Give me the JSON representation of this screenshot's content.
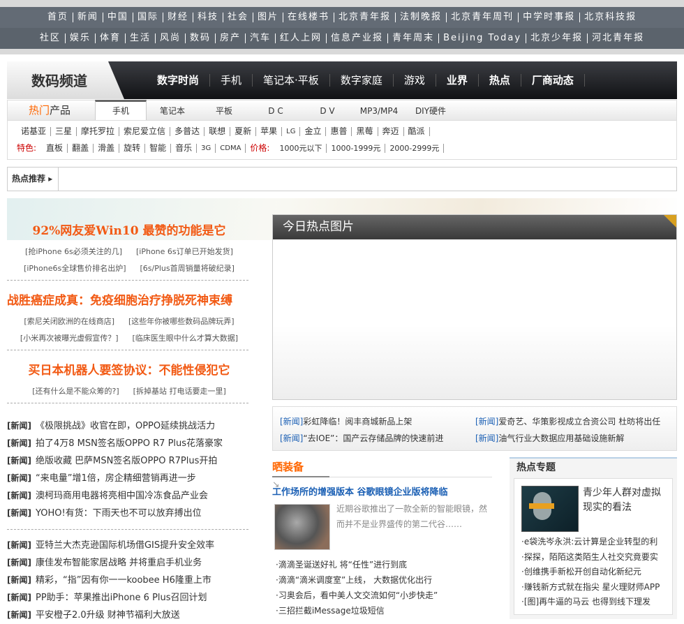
{
  "topnav": {
    "row1": [
      "首页",
      "新闻",
      "中国",
      "国际",
      "财经",
      "科技",
      "社会",
      "图片",
      "在线楼书",
      "北京青年报",
      "法制晚报",
      "北京青年周刊",
      "中学时事报",
      "北京科技报"
    ],
    "row2": [
      "社区",
      "娱乐",
      "体育",
      "生活",
      "风尚",
      "数码",
      "房产",
      "汽车",
      "红人上网",
      "信息产业报",
      "青年周末",
      "Beijing  Today",
      "北京少年报",
      "河北青年报"
    ]
  },
  "channel": {
    "title": "数码频道",
    "nav": [
      "数字时尚",
      "手机",
      "笔记本·平板",
      "数字家庭",
      "游戏",
      "业界",
      "热点",
      "厂商动态"
    ]
  },
  "products": {
    "title_hot": "热门",
    "title_rest": "产品",
    "tabs": [
      "手机",
      "笔记本",
      "平板",
      "D C",
      "D V",
      "MP3/MP4",
      "DIY硬件"
    ],
    "brands": [
      "诺基亚",
      "三星",
      "摩托罗拉",
      "索尼爱立信",
      "多普达",
      "联想",
      "夏新",
      "苹果",
      "LG",
      "金立",
      "惠普",
      "黑莓",
      "奔迈",
      "酷派"
    ],
    "feature_label": "特色:",
    "features": [
      "直板",
      "翻盖",
      "滑盖",
      "旋转",
      "智能",
      "音乐",
      "3G",
      "CDMA"
    ],
    "price_label": "价格:",
    "prices": [
      "1000元以下",
      "1000-1999元",
      "2000-2999元"
    ]
  },
  "hot_rec": {
    "label": "热点推荐"
  },
  "headlines": [
    {
      "title": "92%网友爱Win10 最赞的功能是它",
      "subs": [
        [
          "[抢iPhone 6s必须关注的几]",
          "[iPhone 6s订单已开始发货]"
        ],
        [
          "[iPhone6s全球售价排名出炉]",
          "[6s/Plus首周销量将破纪录]"
        ]
      ]
    },
    {
      "title": "战胜癌症成真：免疫细胞治疗挣脱死神束缚",
      "subs": [
        [
          "[索尼关闭欧洲的在线商店]",
          "[这些年你被哪些数码品牌玩弄]"
        ],
        [
          "[小米再次被曝光虚假宣传？]",
          "[临床医生眼中什么才算大数据]"
        ]
      ]
    },
    {
      "title": "买日本机器人要签协议：不能性侵犯它",
      "subs": [
        [
          "[还有什么是不能众筹的?]",
          "[拆掉基站 打电话要走一里]"
        ]
      ]
    }
  ],
  "news_tag": "[新闻]",
  "news1": [
    "《极限挑战》收官在即，OPPO延续挑战活力",
    "拍了4万8 MSN签名版OPPO R7 Plus花落豪家",
    "绝版收藏 巴萨MSN签名版OPPO R7Plus开拍",
    "“来电量”增1倍，房企精细营销再进一步",
    "澳柯玛商用电器将亮相中国冷冻食品产业会",
    "YOHO!有货：下雨天也不可以放弃搏出位"
  ],
  "news2": [
    "亚特兰大杰克逊国际机场借GIS提升安全效率",
    "康佳发布智能家居战略 并将重启手机业务",
    "精彩，“指”因有你一一koobee H6隆重上市",
    "PP助手：苹果推出iPhone 6 Plus召回计划",
    "平安橙子2.0升级 财神节福利大放送"
  ],
  "pic": {
    "title": "今日热点图片"
  },
  "picnews": [
    "彩虹降临！阅丰商城新品上架",
    "爱奇艺、华策影视成立合资公司 杜昉将出任",
    "“去IOE”：国产云存储品牌的快速前进",
    "油气行业大数据应用基础设施新解"
  ],
  "gear": {
    "title": "晒装备",
    "headline": "工作场所的增强版本 谷歌眼镜企业版将降临",
    "desc": "近期谷歌推出了一款全新的智能眼镜，然而并不是业界盛传的第二代谷……",
    "list": [
      "·滴滴圣诞送好礼 将“任性”进行到底",
      "·滴滴“滴米调度室”上线， 大数据优化出行",
      "·习奥会后，看中美人文交流如何“小步快走”",
      "·三招拦截iMessage垃圾短信"
    ]
  },
  "topic": {
    "title": "热点专题",
    "feature": "青少年人群对虚拟现实的看法",
    "list": [
      "·e袋洗岑永洪:云计算是企业转型的利",
      "·探探，陌陌这类陌生人社交究竟要实",
      "·创维携手新松开创自动化新纪元",
      "·赚钱新方式就在指尖 星火理财师APP",
      "·[图]再牛逼的马云 也得到线下理发"
    ]
  }
}
